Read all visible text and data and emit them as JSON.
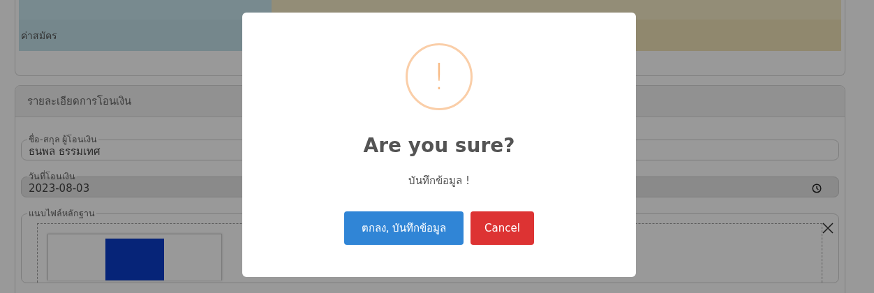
{
  "fee_table": {
    "rows": [
      {
        "label": "ค่าสมัคร",
        "value": ""
      }
    ]
  },
  "transfer_details": {
    "title": "รายละเอียดการโอนเงิน",
    "fields": [
      {
        "kind": "text",
        "label": "ชื่อ-สกุล ผู้โอนเงิน",
        "value": "ธนพล ธรรมเทศ",
        "disabled": false
      },
      {
        "kind": "time",
        "label": "วันที่โอนเงิน",
        "value": "2023-08-03",
        "disabled": true
      }
    ],
    "attachment": {
      "label": "แนบไฟล์หลักฐาน"
    }
  },
  "dialog": {
    "icon": "!",
    "title": "Are you sure?",
    "text": "บันทึกข้อมูล !",
    "buttons": [
      {
        "kind": "confirm",
        "label": "ตกลง, บันทึกข้อมูล"
      },
      {
        "kind": "cancel",
        "label": "Cancel"
      }
    ]
  }
}
